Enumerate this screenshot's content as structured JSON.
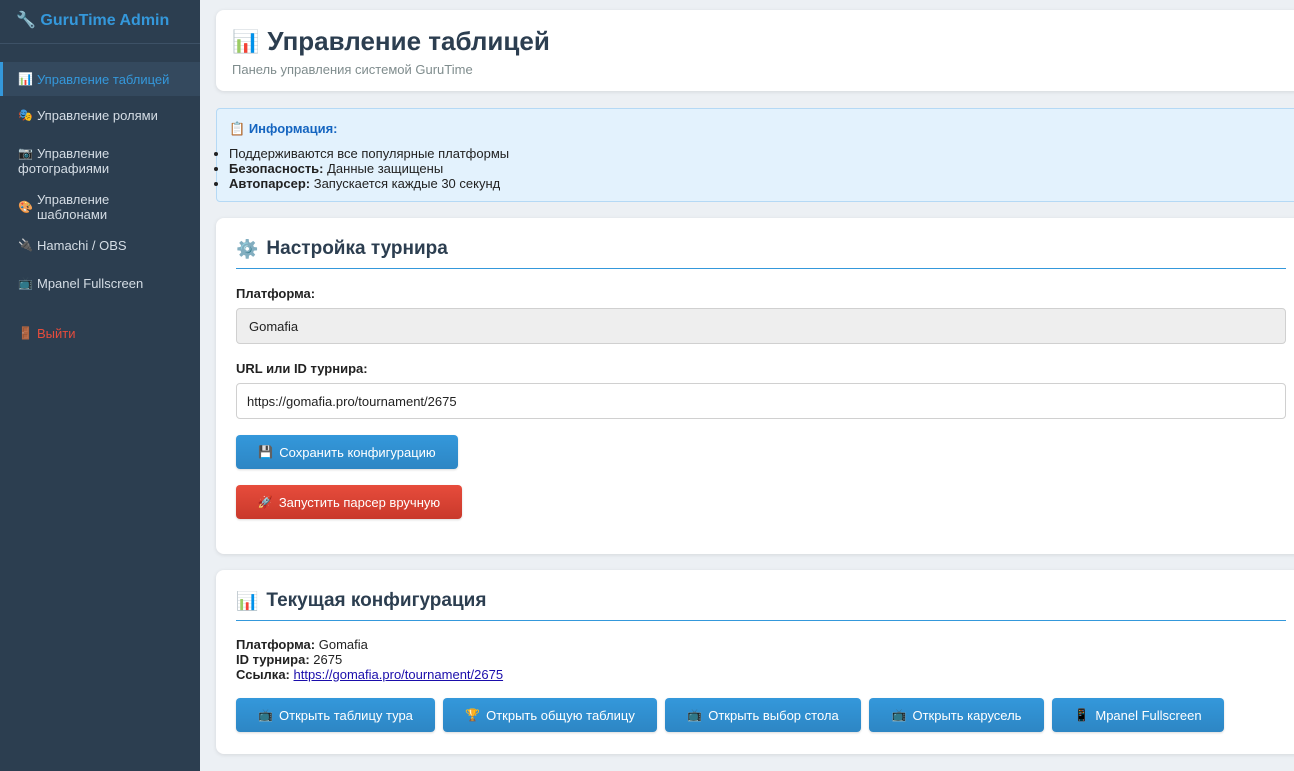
{
  "sidebar": {
    "brand_icon": "🔧",
    "brand": "GuruTime Admin",
    "items": [
      {
        "icon": "📊",
        "label": "Управление таблицей"
      },
      {
        "icon": "🎭",
        "label": "Управление ролями"
      },
      {
        "icon": "📷",
        "label": "Управление фотографиями"
      },
      {
        "icon": "🎨",
        "label": "Управление шаблонами"
      },
      {
        "icon": "🔌",
        "label": "Hamachi / OBS"
      },
      {
        "icon": "📺",
        "label": "Mpanel Fullscreen"
      }
    ],
    "logout": {
      "icon": "🚪",
      "label": "Выйти"
    }
  },
  "header": {
    "icon": "📊",
    "title": "Управление таблицей",
    "subtitle": "Панель управления системой GuruTime"
  },
  "info": {
    "icon": "📋",
    "title": "Информация:",
    "items": [
      {
        "bold": "",
        "text": "Поддерживаются все популярные платформы"
      },
      {
        "bold": "Безопасность:",
        "text": " Данные защищены"
      },
      {
        "bold": "Автопарсер:",
        "text": " Запускается каждые 30 секунд"
      }
    ]
  },
  "settings": {
    "icon": "⚙️",
    "title": "Настройка турнира",
    "platform_label": "Платформа:",
    "platform_value": "Gomafia",
    "url_label": "URL или ID турнира:",
    "url_value": "https://gomafia.pro/tournament/2675",
    "save_icon": "💾",
    "save_label": "Сохранить конфигурацию",
    "run_icon": "🚀",
    "run_label": "Запустить парсер вручную"
  },
  "config": {
    "icon": "📊",
    "title": "Текущая конфигурация",
    "platform_key": "Платформа:",
    "platform_value": " Gomafia",
    "id_key": "ID турнира:",
    "id_value": " 2675",
    "link_key": "Ссылка:",
    "link_value": "https://gomafia.pro/tournament/2675",
    "buttons": [
      {
        "icon": "📺",
        "label": "Открыть таблицу тура"
      },
      {
        "icon": "🏆",
        "label": "Открыть общую таблицу"
      },
      {
        "icon": "📺",
        "label": "Открыть выбор стола"
      },
      {
        "icon": "📺",
        "label": "Открыть карусель"
      },
      {
        "icon": "📱",
        "label": "Mpanel Fullscreen"
      }
    ]
  },
  "colors": {
    "sidebar_bg": "#2c3e50",
    "accent": "#3498db",
    "danger": "#e74c3c",
    "info_bg": "#e3f2fd"
  }
}
